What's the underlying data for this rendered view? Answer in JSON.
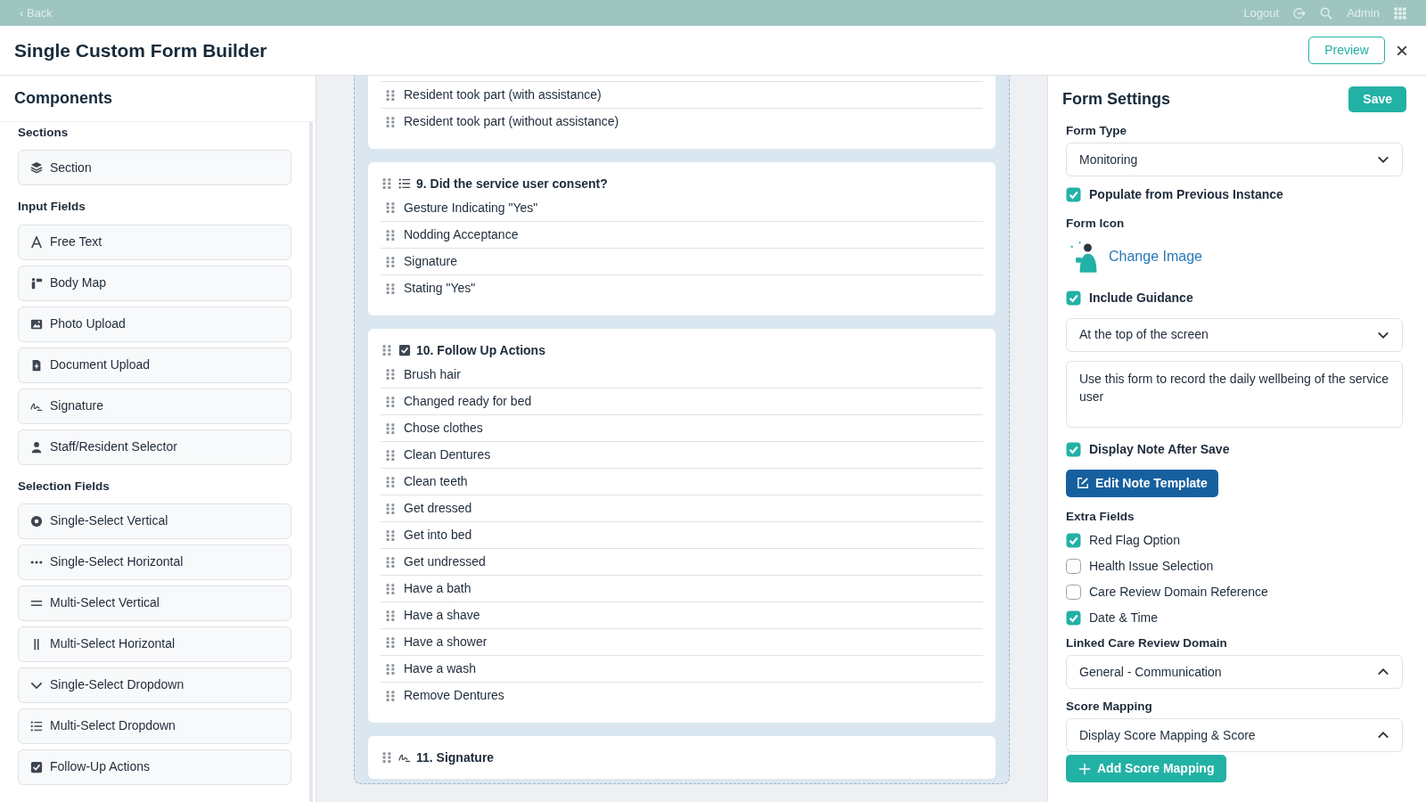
{
  "top_bar": {
    "back": "‹ Back",
    "logout": "Logout",
    "user": "Admin"
  },
  "header": {
    "title": "Single Custom Form Builder",
    "preview": "Preview",
    "close": "×"
  },
  "components": {
    "title": "Components",
    "groups": [
      {
        "label": "Sections",
        "items": [
          {
            "label": "Section",
            "kind": "layers"
          }
        ]
      },
      {
        "label": "Input Fields",
        "items": [
          {
            "label": "Free Text",
            "kind": "letter"
          },
          {
            "label": "Body Map",
            "kind": "body-map"
          },
          {
            "label": "Photo Upload",
            "kind": "image"
          },
          {
            "label": "Document Upload",
            "kind": "document"
          },
          {
            "label": "Signature",
            "kind": "signature"
          },
          {
            "label": "Staff/Resident Selector",
            "kind": "person"
          }
        ]
      },
      {
        "label": "Selection Fields",
        "items": [
          {
            "label": "Single-Select Vertical",
            "kind": "radio"
          },
          {
            "label": "Single-Select Horizontal",
            "kind": "dots"
          },
          {
            "label": "Multi-Select Vertical",
            "kind": "equals"
          },
          {
            "label": "Multi-Select Horizontal",
            "kind": "bars"
          },
          {
            "label": "Single-Select Dropdown",
            "kind": "chevron"
          },
          {
            "label": "Multi-Select Dropdown",
            "kind": "list"
          },
          {
            "label": "Follow-Up Actions",
            "kind": "checkbox"
          }
        ]
      }
    ]
  },
  "canvas": {
    "sections": [
      {
        "kind": "continued",
        "options": [
          "Resident took part (with assistance)",
          "Resident took part (without assistance)"
        ]
      },
      {
        "kind": "list",
        "title": "9. Did the service user consent?",
        "options": [
          "Gesture Indicating \"Yes\"",
          "Nodding Acceptance",
          "Signature",
          "Stating \"Yes\""
        ]
      },
      {
        "kind": "checkbox",
        "title": "10. Follow Up Actions",
        "options": [
          "Brush hair",
          "Changed ready for bed",
          "Chose clothes",
          "Clean Dentures",
          "Clean teeth",
          "Get dressed",
          "Get into bed",
          "Get undressed",
          "Have a bath",
          "Have a shave",
          "Have a shower",
          "Have a wash",
          "Remove Dentures"
        ]
      },
      {
        "kind": "signature",
        "title": "11. Signature"
      }
    ]
  },
  "settings": {
    "title": "Form Settings",
    "save": "Save",
    "fields": [
      {
        "kind": "select",
        "label": "Form Type",
        "value": "Monitoring",
        "expanded": false
      },
      {
        "kind": "checkbox",
        "label": "Populate from Previous Instance",
        "checked": true
      },
      {
        "kind": "image",
        "label": "Form Icon",
        "link": "Change Image"
      },
      {
        "kind": "checkbox",
        "label": "Include Guidance",
        "checked": true
      },
      {
        "kind": "select",
        "value": "At the top of the screen",
        "expanded": false
      },
      {
        "kind": "textarea",
        "value": "Use this form to record the daily wellbeing of the service user"
      },
      {
        "kind": "checkbox",
        "label": "Display Note After Save",
        "checked": true
      },
      {
        "kind": "edit-button",
        "label": "Edit Note Template"
      },
      {
        "kind": "checklist",
        "label": "Extra Fields",
        "options": [
          {
            "label": "Red Flag Option",
            "checked": true
          },
          {
            "label": "Health Issue Selection",
            "checked": false
          },
          {
            "label": "Care Review Domain Reference",
            "checked": false
          },
          {
            "label": "Date & Time",
            "checked": true
          }
        ]
      },
      {
        "kind": "select",
        "label": "Linked Care Review Domain",
        "value": "General - Communication",
        "expanded": true
      },
      {
        "kind": "select",
        "label": "Score Mapping",
        "value": "Display Score Mapping & Score",
        "expanded": true
      },
      {
        "kind": "add-button",
        "label": "Add Score Mapping"
      }
    ]
  }
}
